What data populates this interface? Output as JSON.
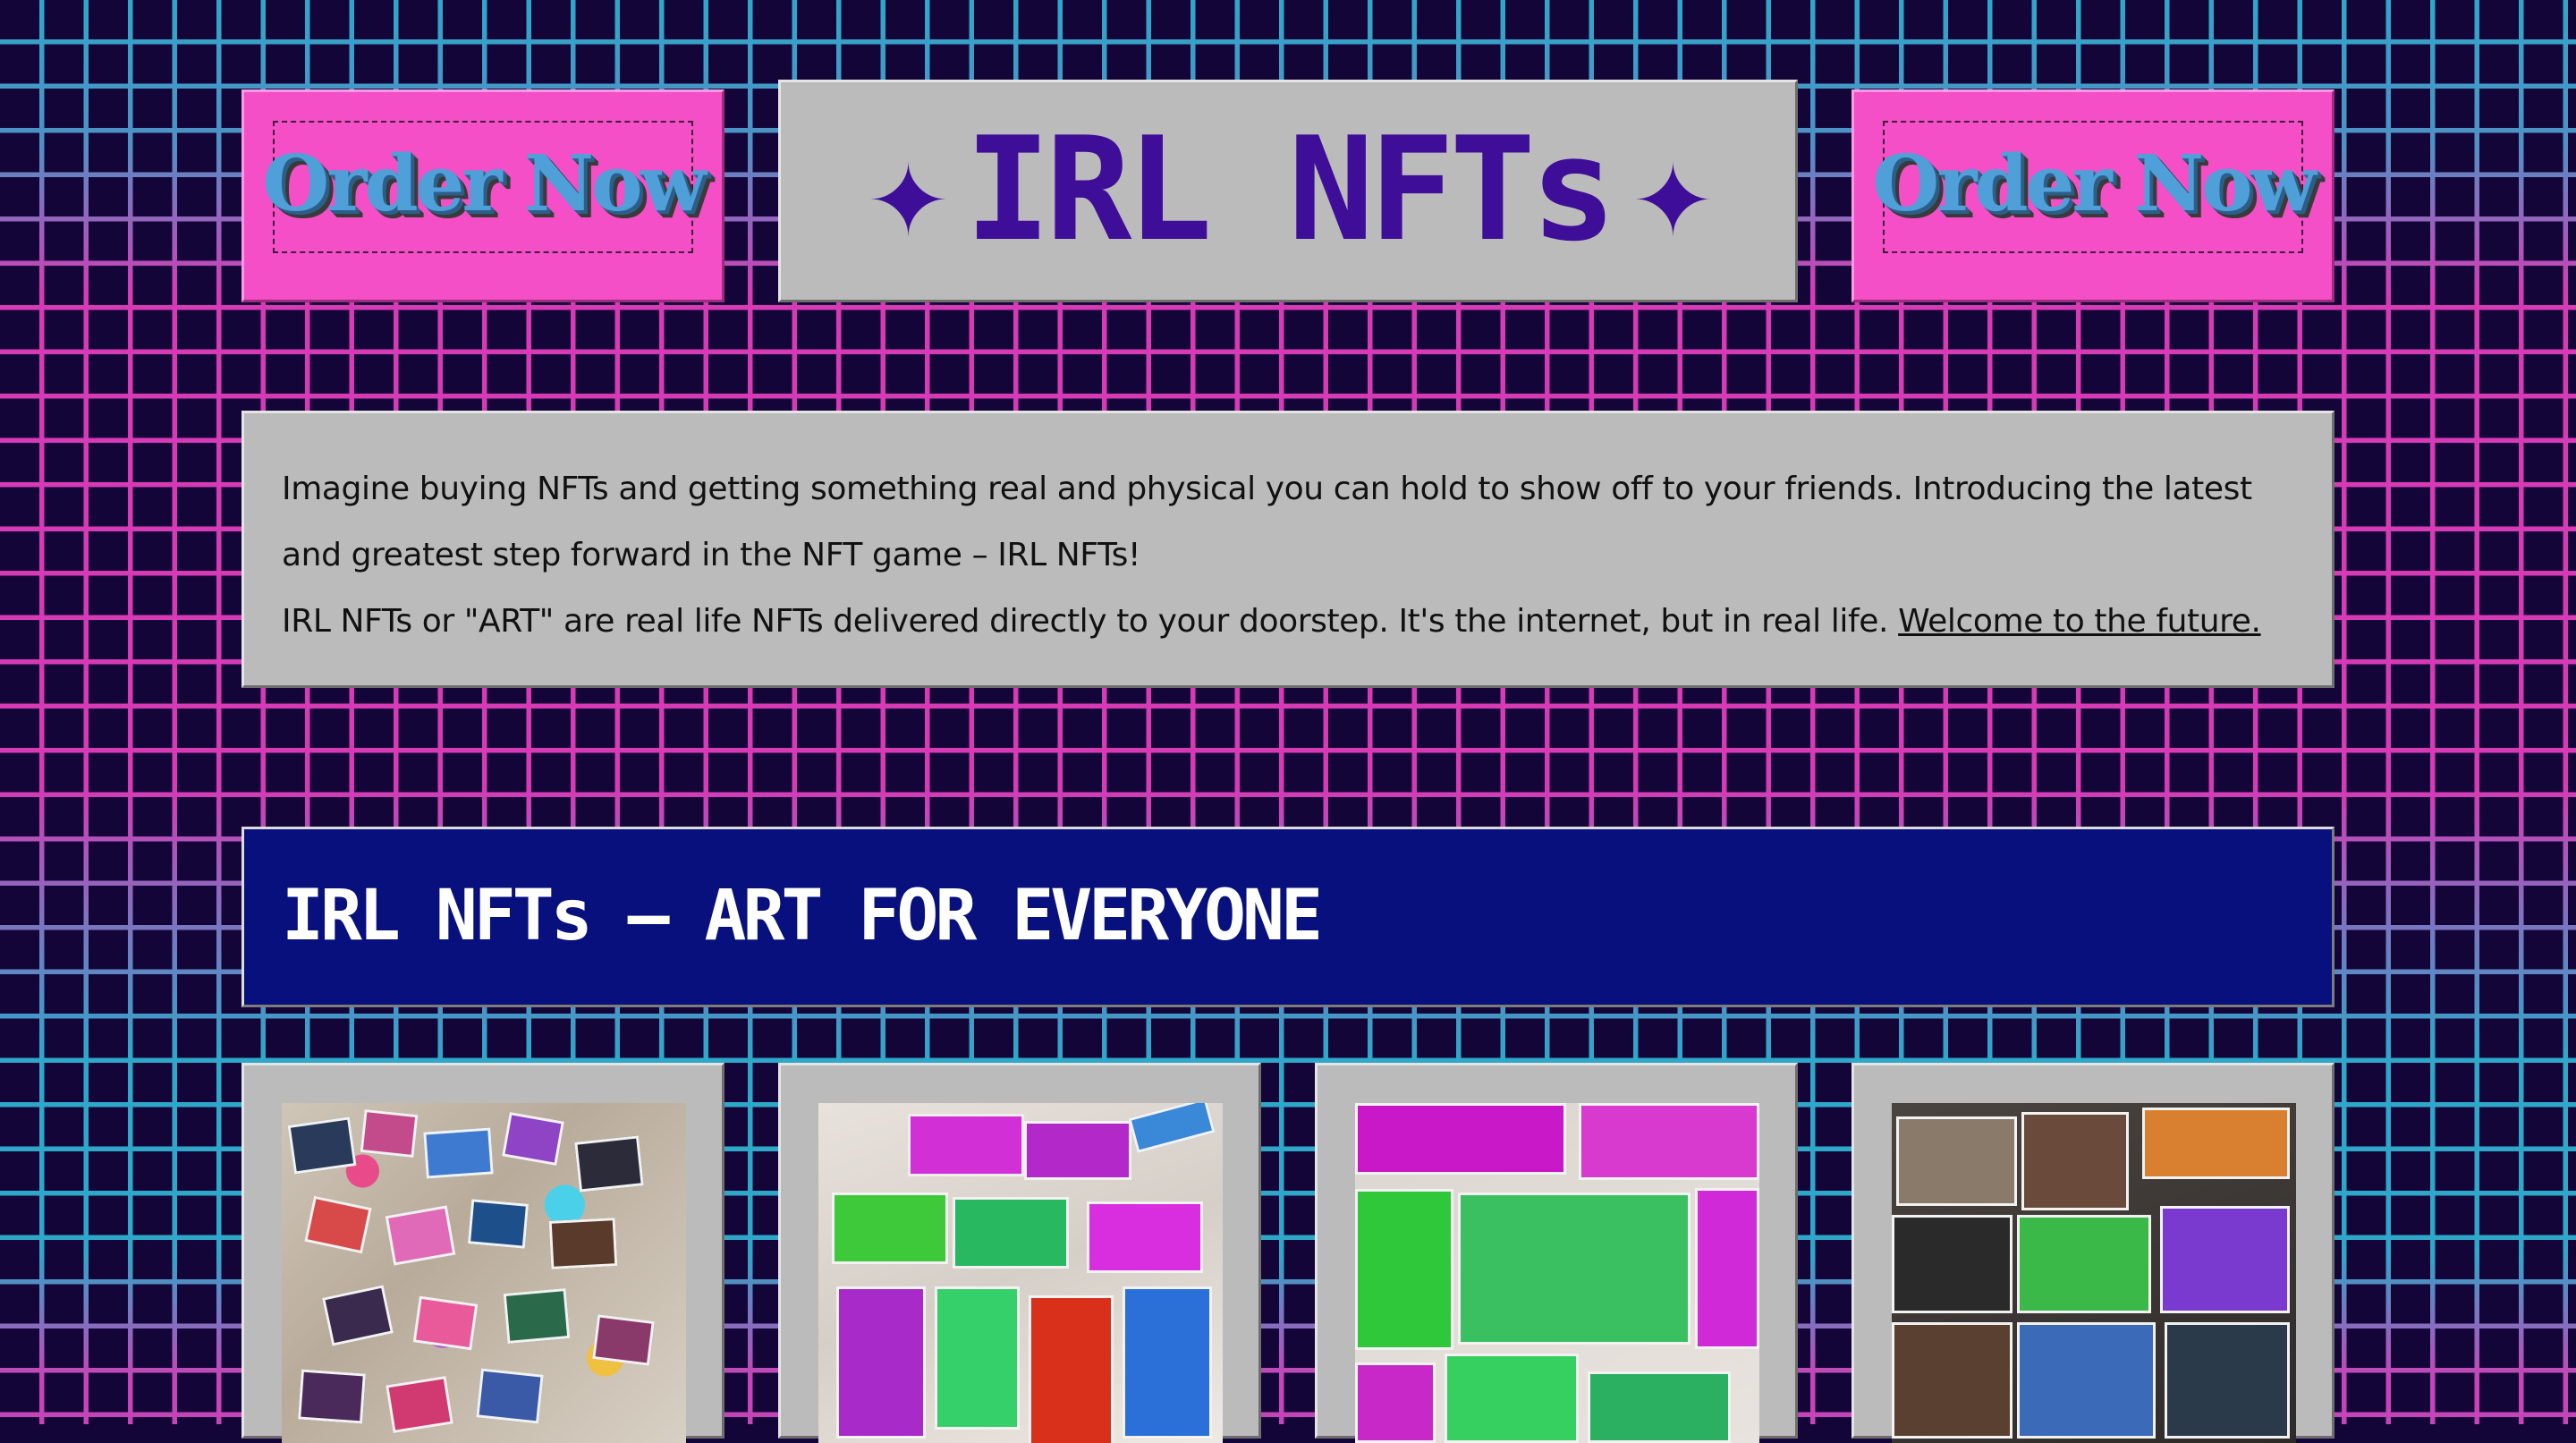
{
  "header": {
    "order_left_label": "Order Now",
    "order_right_label": "Order Now",
    "title_text": "IRL NFTs",
    "title_star": "✦"
  },
  "intro": {
    "line1": "Imagine buying NFTs and getting something real and physical you can hold to show off to your friends. Introducing the latest and greatest step forward in the NFT game – IRL NFTs!",
    "line2": "IRL NFTs or \"ART\" are real life NFTs delivered directly to your doorstep. It's the internet, but in real life. ",
    "link": "Welcome to the future."
  },
  "banner": {
    "heading": "IRL NFTs — ART FOR EVERYONE"
  },
  "gallery": {
    "items": [
      {
        "name": "photo-collage-1"
      },
      {
        "name": "photo-collage-2"
      },
      {
        "name": "photo-collage-3"
      },
      {
        "name": "photo-collage-4"
      }
    ]
  },
  "colors": {
    "background": "#140538",
    "grid_cyan": "#2fa7c9",
    "grid_magenta": "#d63ab5",
    "button_pink": "#f44fc6",
    "panel_grey": "#bbbbbb",
    "title_purple": "#3f0e99",
    "banner_blue": "#07107c"
  }
}
